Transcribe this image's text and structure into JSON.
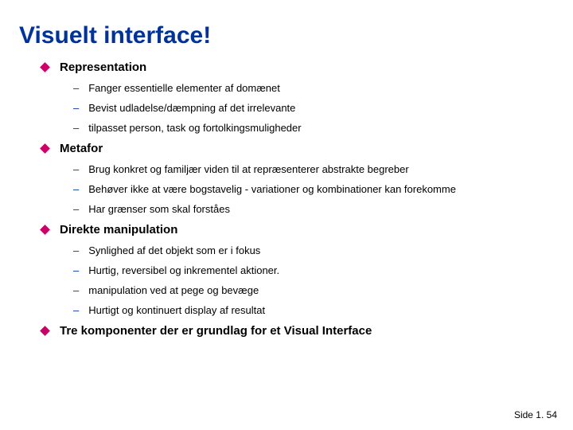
{
  "title": "Visuelt interface!",
  "items": [
    {
      "label": "Representation",
      "sub": [
        "Fanger essentielle elementer af domænet",
        "Bevist udladelse/dæmpning af det irrelevante",
        "tilpasset person,  task og fortolkingsmuligheder"
      ]
    },
    {
      "label": "Metafor",
      "sub": [
        "Brug konkret og familjær viden til at repræsenterer abstrakte begreber",
        "Behøver ikke at være bogstavelig  - variationer og kombinationer kan forekomme",
        "Har grænser som skal forståes"
      ]
    },
    {
      "label": "Direkte manipulation",
      "sub": [
        "Synlighed af det objekt som er i fokus",
        "Hurtig, reversibel og inkrementel aktioner.",
        "manipulation ved at pege og bevæge",
        "Hurtigt og kontinuert display af resultat"
      ]
    },
    {
      "label": "Tre komponenter der er grundlag for et Visual Interface",
      "sub": []
    }
  ],
  "footer": "Side 1. 54"
}
